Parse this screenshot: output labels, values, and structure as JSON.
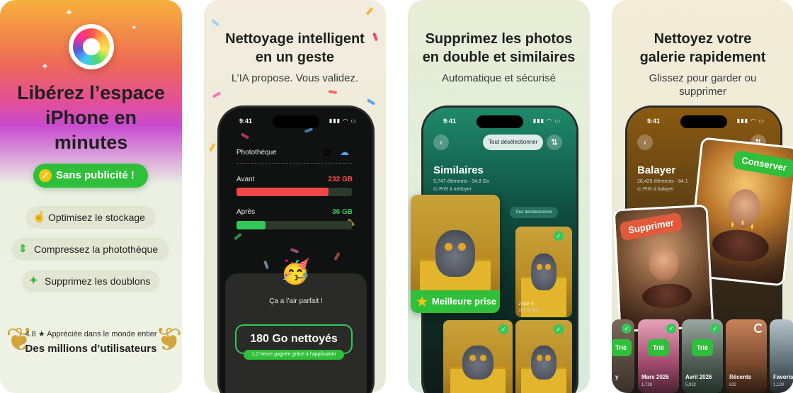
{
  "panel1": {
    "headline": [
      "Libérez l’espace",
      "iPhone en",
      "minutes"
    ],
    "badge": "Sans publicité !",
    "features": [
      {
        "label": "Optimisez le stockage",
        "icon": "hand-tap-icon"
      },
      {
        "label": "Compressez la photothèque",
        "icon": "compress-icon"
      },
      {
        "label": "Supprimez les doublons",
        "icon": "sparkle-icon"
      }
    ],
    "rating_score": "4.8",
    "rating_text": "Appréciée dans le monde entier",
    "users": "Des millions d’utilisateurs",
    "colors": {
      "accent_green": "#2fbf3a",
      "laurel_gold": "#d2a43c"
    }
  },
  "panel2": {
    "headline": [
      "Nettoyage intelligent",
      "en un geste"
    ],
    "subline": "L’IA propose. Vous validez.",
    "phone": {
      "time": "9:41",
      "section": "Photothèque",
      "before_label": "Avant",
      "before_value": "232 GB",
      "before_fraction": 0.8,
      "after_label": "Après",
      "after_value": "36 GB",
      "after_fraction": 0.25,
      "emoji": "🥳",
      "status": "Ça a l’air parfait !",
      "result": "180 Go nettoyés",
      "saved": "1,2 heure gagnée grâce à l’application"
    }
  },
  "panel3": {
    "headline": [
      "Supprimez les photos",
      "en double et similaires"
    ],
    "subline": "Automatique et sécurisé",
    "phone": {
      "time": "9:41",
      "deselect": "Tout désélectionner",
      "title": "Similaires",
      "stats": "9,747 éléments · 34.8 Go",
      "ready": "Prêt à nettoyer",
      "deselect_small": "Tout désélectionner",
      "group_index": "2 sur 4",
      "group_size": "267.95 MB",
      "best_shot": "Meilleure prise"
    }
  },
  "panel4": {
    "headline": [
      "Nettoyez votre",
      "galerie rapidement"
    ],
    "subline": [
      "Glissez pour garder ou",
      "supprimer"
    ],
    "phone": {
      "time": "9:41",
      "title": "Balayer",
      "stats": "26,429 éléments · 84.1",
      "ready": "Prêt à balayer",
      "keep": "Conserver",
      "delete": "Supprimer"
    },
    "thumbnails": [
      {
        "label": "y",
        "count": "",
        "sorted": "Trié"
      },
      {
        "label": "Mars 2026",
        "count": "1,728",
        "sorted": "Trié"
      },
      {
        "label": "Avril 2026",
        "count": "5,932",
        "sorted": "Trié"
      },
      {
        "label": "Récents",
        "count": "632",
        "sorted": ""
      },
      {
        "label": "Favoris",
        "count": "1,129",
        "sorted": ""
      }
    ]
  }
}
